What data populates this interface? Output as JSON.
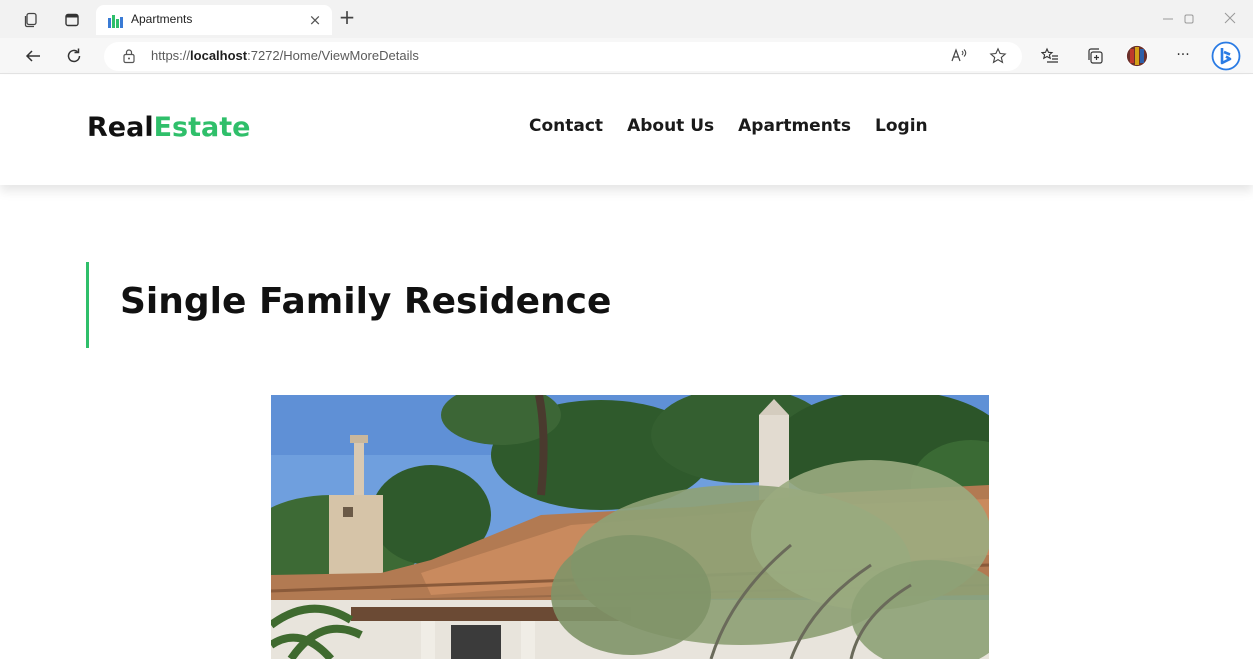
{
  "browser": {
    "tab_title": "Apartments",
    "tab_close_glyph": "×",
    "new_tab_glyph": "+",
    "url_prefix": "https://",
    "url_host": "localhost",
    "url_rest": ":7272/Home/ViewMoreDetails",
    "more_glyph": "···",
    "icons": [
      "workspaces-icon",
      "tab-actions-icon",
      "back-icon",
      "refresh-icon",
      "site-info-icon",
      "read-aloud-icon",
      "favorite-star-icon",
      "favorites-icon",
      "collections-icon",
      "profile-avatar-icon",
      "more-icon",
      "bing-copilot-icon",
      "minimize-icon",
      "restore-icon",
      "close-window-icon"
    ]
  },
  "site": {
    "logo_part1": "Real",
    "logo_part2": "Estate",
    "nav": [
      "Contact",
      "About Us",
      "Apartments",
      "Login"
    ],
    "accent_color": "#2fbf6a"
  },
  "main": {
    "title": "Single Family Residence",
    "photo_alt": "house-photo"
  }
}
